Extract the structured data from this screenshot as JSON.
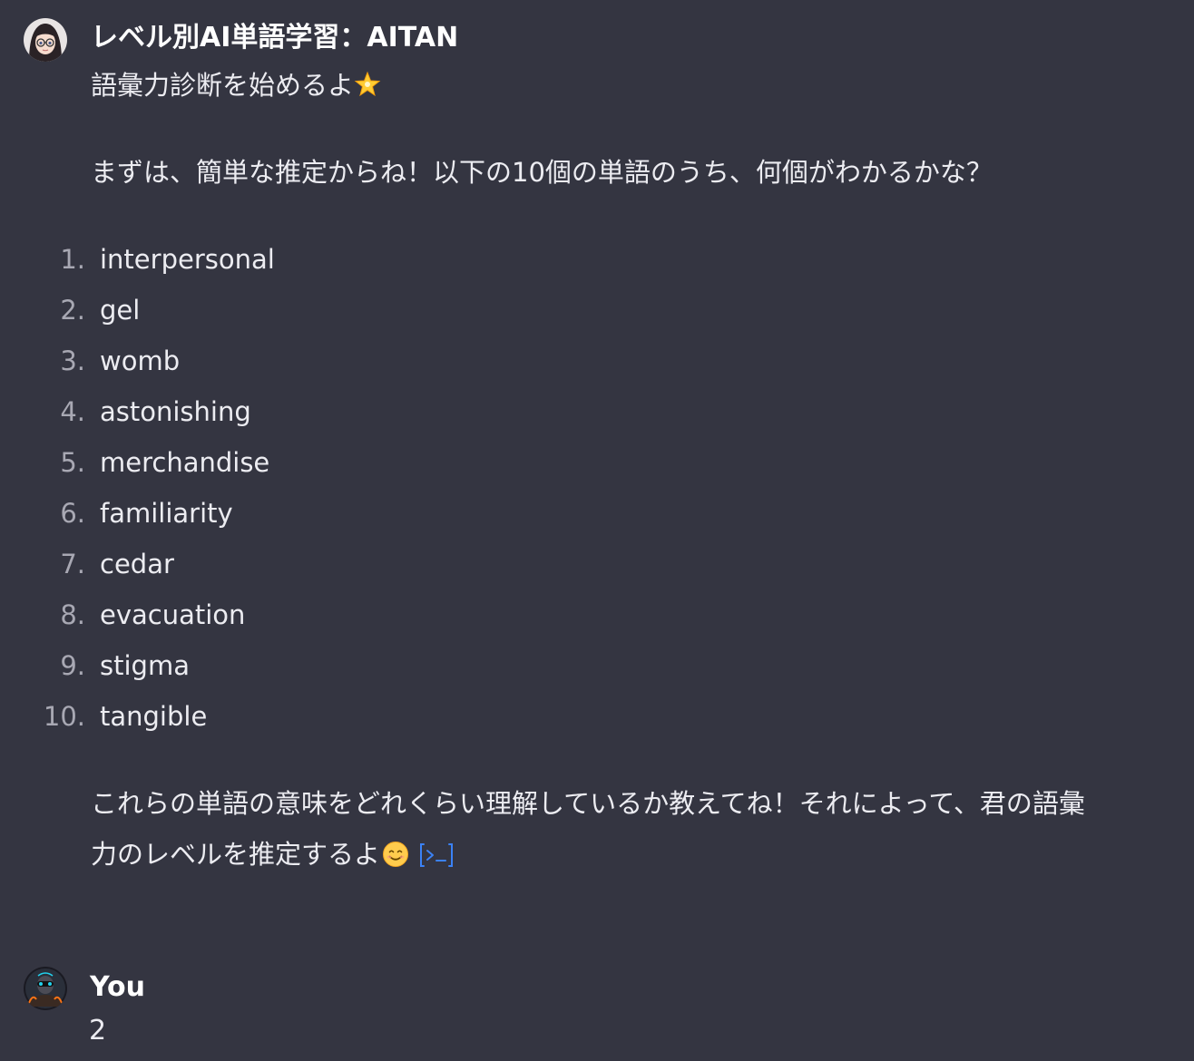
{
  "assistant": {
    "name": "レベル別AI単語学習：AITAN",
    "intro": "語彙力診断を始めるよ",
    "intro_emoji": "sparkle-star",
    "question": "まずは、簡単な推定からね！以下の10個の単語のうち、何個がわかるかな？",
    "words": [
      {
        "num": "1.",
        "word": "interpersonal"
      },
      {
        "num": "2.",
        "word": "gel"
      },
      {
        "num": "3.",
        "word": "womb"
      },
      {
        "num": "4.",
        "word": "astonishing"
      },
      {
        "num": "5.",
        "word": "merchandise"
      },
      {
        "num": "6.",
        "word": "familiarity"
      },
      {
        "num": "7.",
        "word": "cedar"
      },
      {
        "num": "8.",
        "word": "evacuation"
      },
      {
        "num": "9.",
        "word": "stigma"
      },
      {
        "num": "10.",
        "word": "tangible"
      }
    ],
    "closing_line1": "これらの単語の意味をどれくらい理解しているか教えてね！それによって、君の語彙",
    "closing_line2": "力のレベルを推定するよ",
    "closing_emoji": "smiling-face",
    "code_icon": "code-interpreter-icon",
    "link_color": "#3b82f6"
  },
  "user": {
    "name": "You",
    "message": "2"
  }
}
